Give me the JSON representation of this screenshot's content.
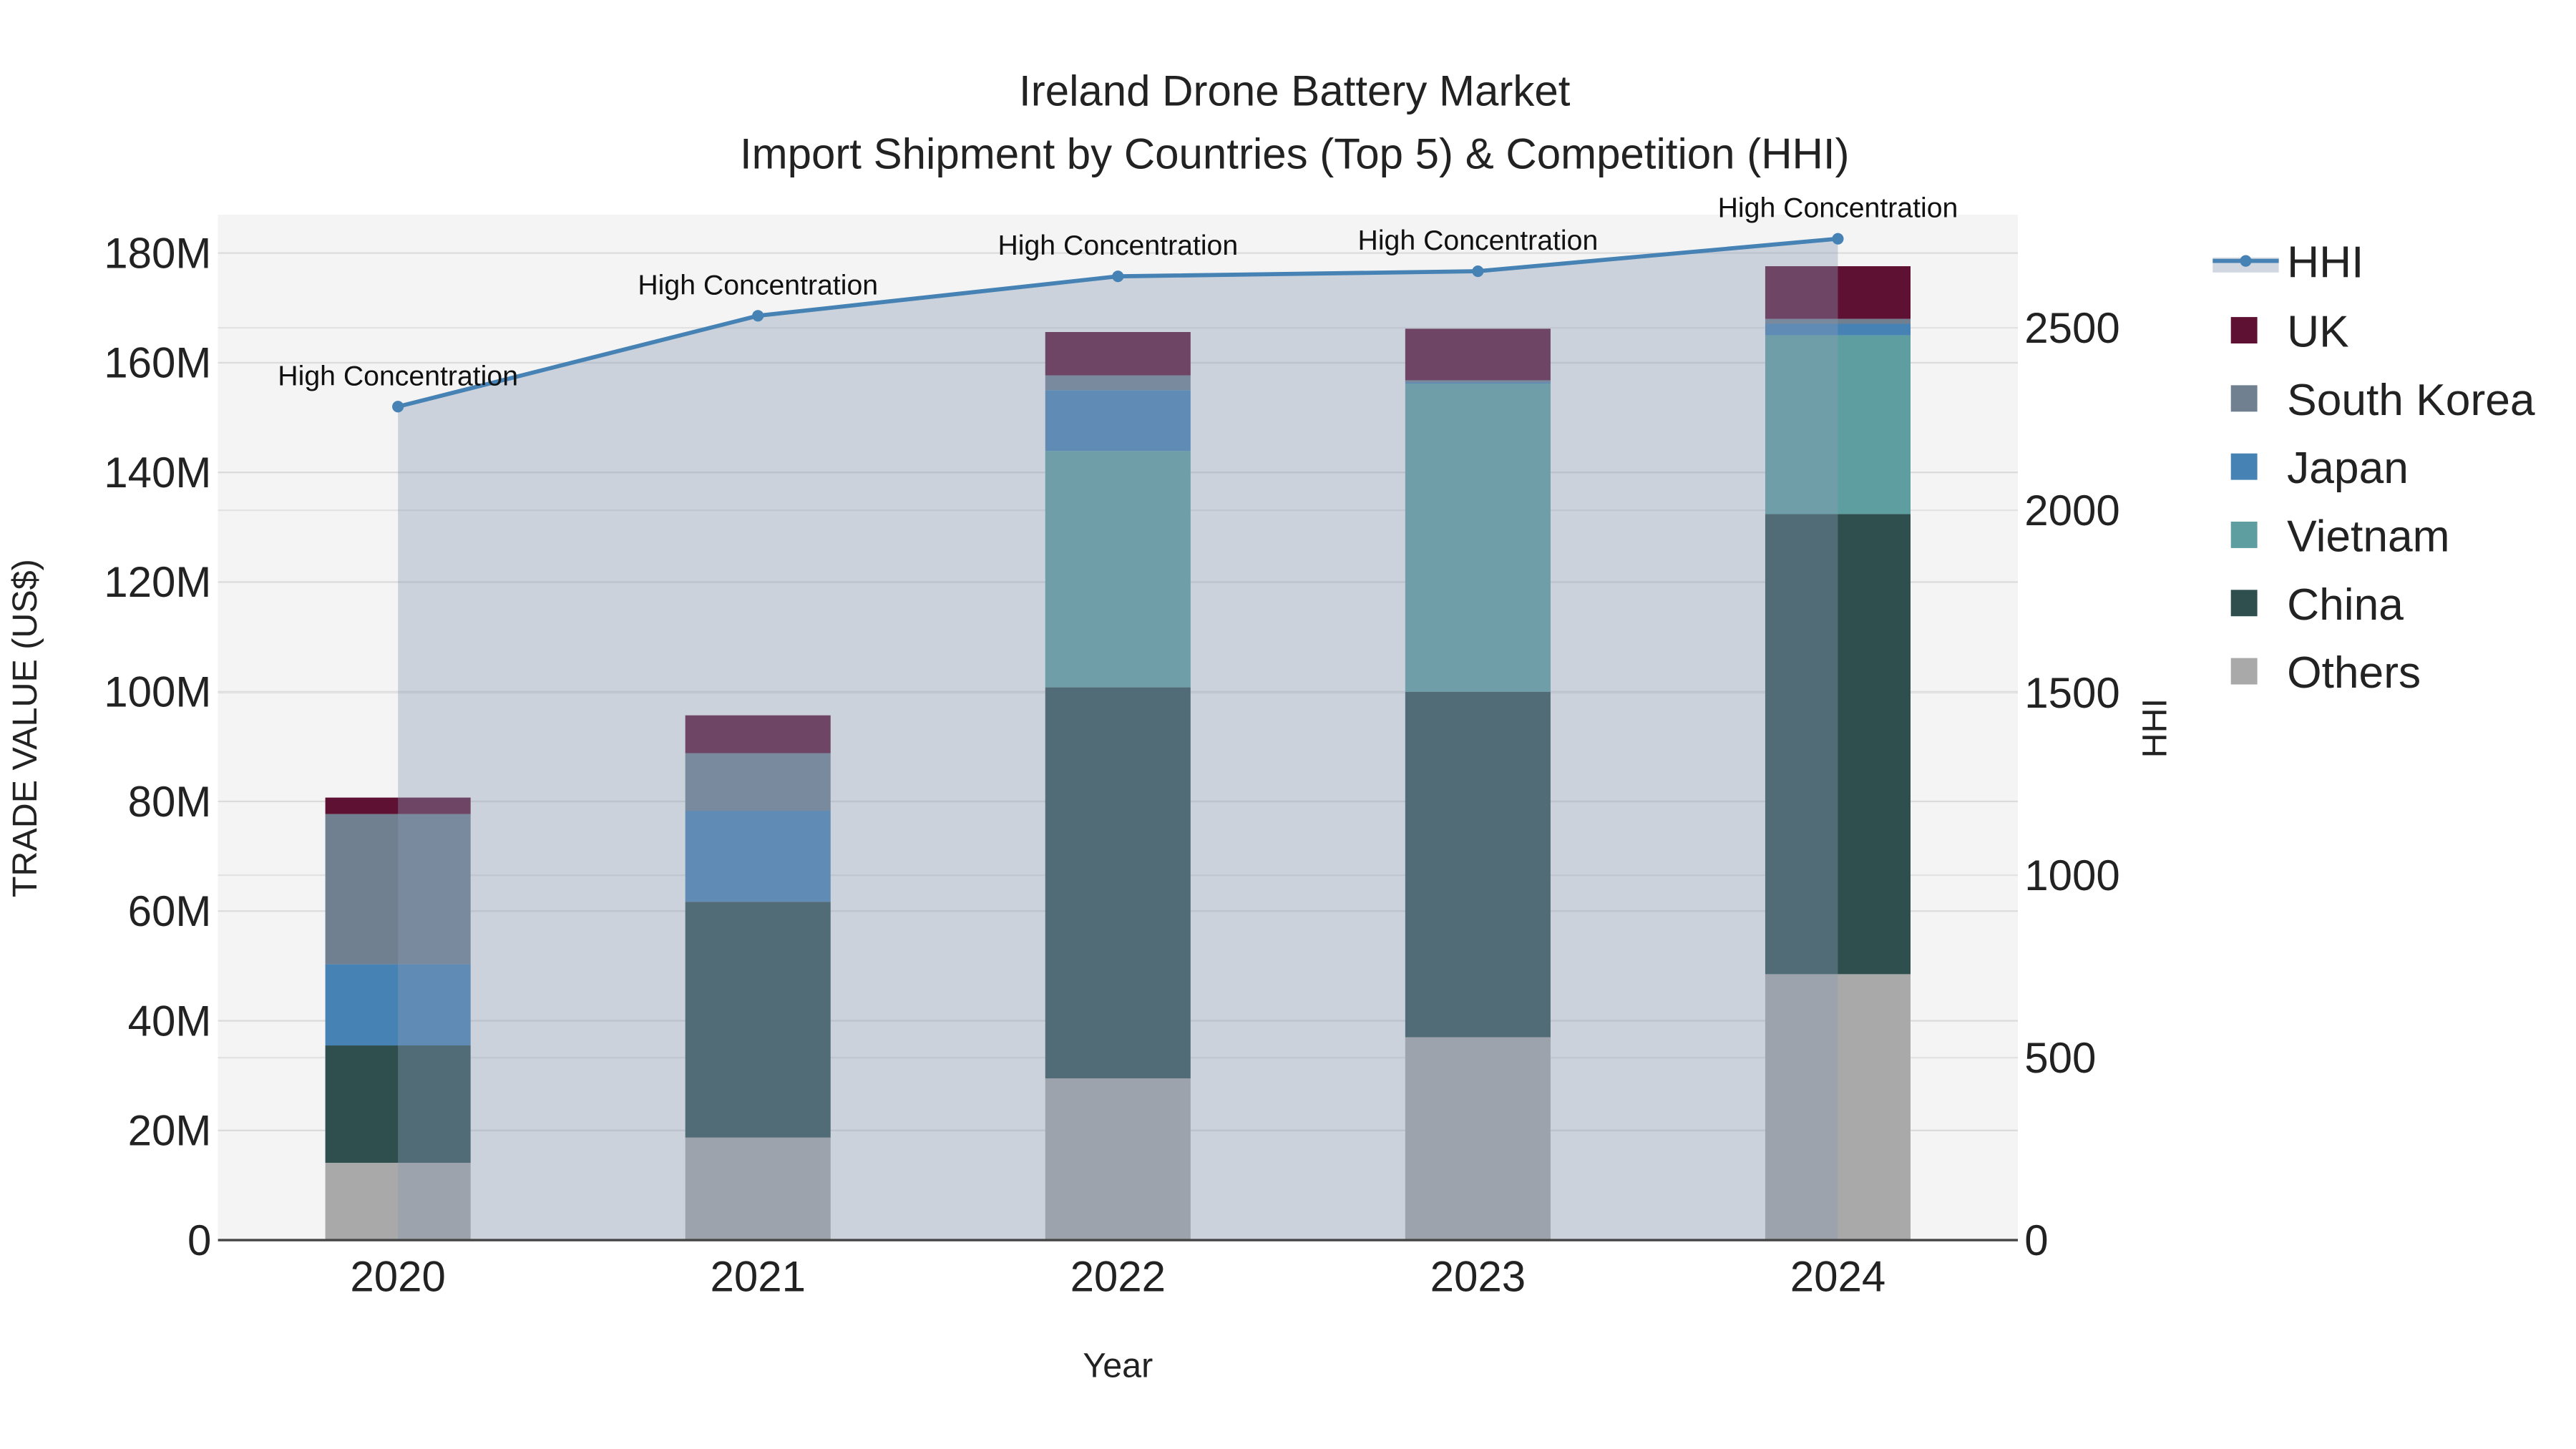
{
  "chart_data": {
    "type": "bar",
    "stacked": true,
    "title": "Ireland Drone Battery Market",
    "subtitle": "Import Shipment by Countries (Top 5) & Competition (HHI)",
    "xlabel": "Year",
    "ylabel": "TRADE VALUE (US$)",
    "y2label": "HHI",
    "categories": [
      "2020",
      "2021",
      "2022",
      "2023",
      "2024"
    ],
    "ylim": [
      0,
      187000000
    ],
    "y_ticks": [
      0,
      20000000,
      40000000,
      60000000,
      80000000,
      100000000,
      120000000,
      140000000,
      160000000,
      180000000
    ],
    "y_tick_labels": [
      "0",
      "20M",
      "40M",
      "60M",
      "80M",
      "100M",
      "120M",
      "140M",
      "160M",
      "180M"
    ],
    "y2lim": [
      0,
      2810
    ],
    "y2_ticks": [
      0,
      500,
      1000,
      1500,
      2000,
      2500
    ],
    "y2_tick_labels": [
      "0",
      "500",
      "1000",
      "1500",
      "2000",
      "2500"
    ],
    "grid": true,
    "legend_placement": "right",
    "series": [
      {
        "name": "Others",
        "color": "#a9a9a9",
        "values": [
          14100000,
          18700000,
          29500000,
          37000000,
          48500000
        ]
      },
      {
        "name": "China",
        "color": "#2f4f4f",
        "values": [
          21400000,
          43000000,
          71300000,
          63000000,
          83900000
        ]
      },
      {
        "name": "Vietnam",
        "color": "#5f9ea0",
        "values": [
          0,
          0,
          43100000,
          56200000,
          32600000
        ]
      },
      {
        "name": "Japan",
        "color": "#4682b4",
        "values": [
          14800000,
          16600000,
          11100000,
          200000,
          2100000
        ]
      },
      {
        "name": "South Korea",
        "color": "#708090",
        "values": [
          27400000,
          10500000,
          2700000,
          400000,
          900000
        ]
      },
      {
        "name": "UK",
        "color": "#5e1133",
        "values": [
          3000000,
          6900000,
          7900000,
          9400000,
          9600000
        ]
      }
    ],
    "line_series": {
      "name": "HHI",
      "color": "#4682b4",
      "values": [
        2284,
        2533,
        2641,
        2655,
        2744
      ],
      "annotations": [
        "High Concentration",
        "High Concentration",
        "High Concentration",
        "High Concentration",
        "High Concentration"
      ]
    },
    "legend_order": [
      "HHI",
      "UK",
      "South Korea",
      "Japan",
      "Vietnam",
      "China",
      "Others"
    ]
  }
}
